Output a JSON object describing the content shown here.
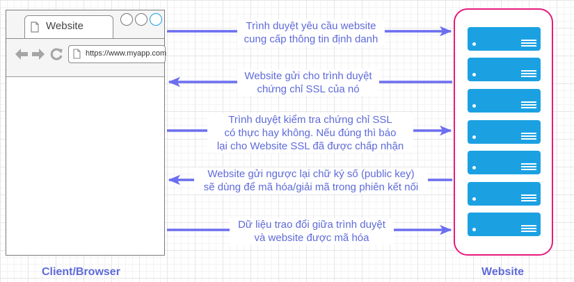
{
  "browser": {
    "tab_title": "Website",
    "url": "https://www.myapp.com"
  },
  "left_caption": "Client/Browser",
  "right_caption": "Website",
  "messages": [
    {
      "line1": "Trình duyệt yêu cầu website",
      "line2": "cung cấp thông tin định danh",
      "line3": "",
      "direction": "right"
    },
    {
      "line1": "Website gửi cho trình duyệt",
      "line2": "chứng chỉ SSL của nó",
      "line3": "",
      "direction": "left"
    },
    {
      "line1": "Trình duyệt kiểm tra chứng chỉ SSL",
      "line2": "có thực hay không. Nếu đúng thì báo",
      "line3": "lại cho Website SSL đã được chấp nhận",
      "direction": "right"
    },
    {
      "line1": "Website gửi ngược lại chữ ký số (public key)",
      "line2": "sẽ dùng để mã hóa/giải mã trong phiên kết nối",
      "line3": "",
      "direction": "left"
    },
    {
      "line1": "Dữ liệu trao đổi giữa trình duyệt",
      "line2": "và website được mã hóa",
      "line3": "",
      "direction": "right"
    }
  ],
  "colors": {
    "arrow": "#6b6ef0",
    "text": "#5e6ad9",
    "server": "#1ba1e2",
    "server_border": "#e6197c"
  },
  "icons": [
    "document-icon",
    "back-arrow-icon",
    "forward-arrow-icon",
    "refresh-icon",
    "server-icon"
  ]
}
